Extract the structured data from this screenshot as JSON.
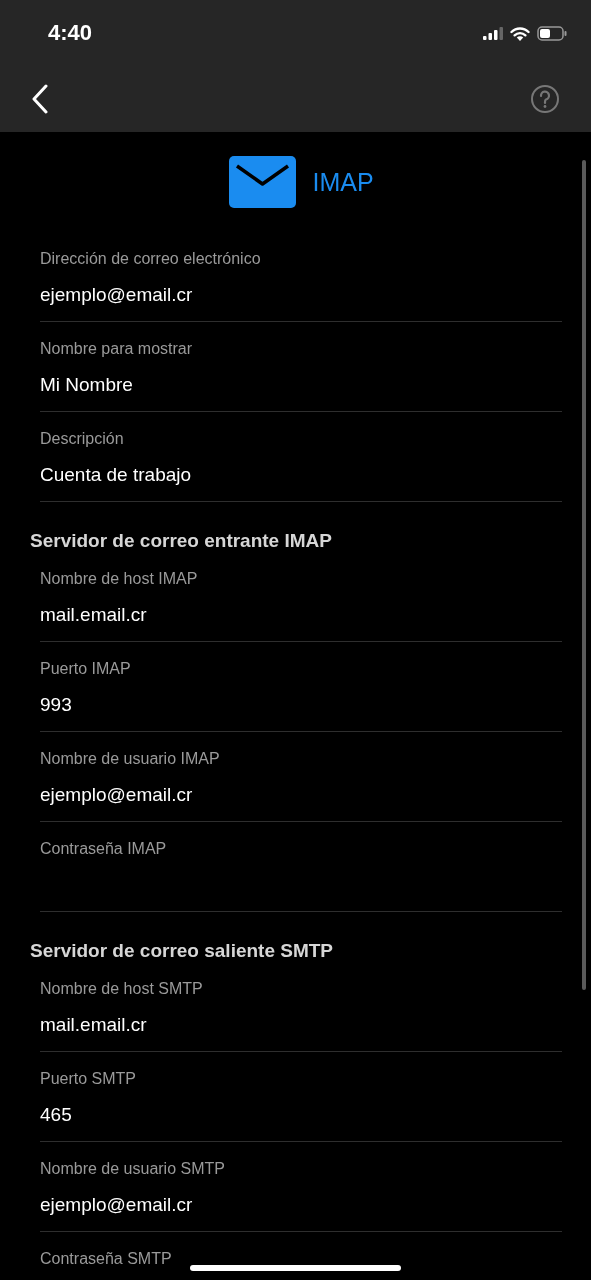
{
  "status_bar": {
    "time": "4:40"
  },
  "account": {
    "title": "IMAP"
  },
  "groups": [
    {
      "fields": [
        {
          "label": "Dirección de correo electrónico",
          "value": "ejemplo@email.cr"
        },
        {
          "label": "Nombre para mostrar",
          "value": "Mi Nombre"
        },
        {
          "label": "Descripción",
          "value": "Cuenta de trabajo"
        }
      ]
    },
    {
      "title": "Servidor de correo entrante IMAP",
      "fields": [
        {
          "label": "Nombre de host IMAP",
          "value": "mail.email.cr"
        },
        {
          "label": "Puerto IMAP",
          "value": "993"
        },
        {
          "label": "Nombre de usuario IMAP",
          "value": "ejemplo@email.cr"
        },
        {
          "label": "Contraseña IMAP"
        }
      ]
    },
    {
      "title": "Servidor de correo saliente SMTP",
      "fields": [
        {
          "label": "Nombre de host SMTP",
          "value": "mail.email.cr"
        },
        {
          "label": "Puerto SMTP",
          "value": "465"
        },
        {
          "label": "Nombre de usuario SMTP",
          "value": "ejemplo@email.cr"
        },
        {
          "label": "Contraseña SMTP"
        }
      ]
    }
  ]
}
